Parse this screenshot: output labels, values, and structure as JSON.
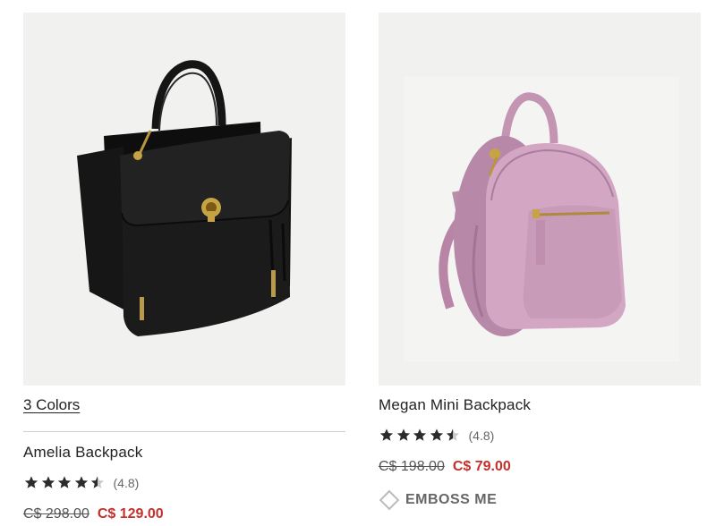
{
  "products": [
    {
      "colors_label": "3 Colors",
      "name": "Amelia Backpack",
      "rating": 4.5,
      "rating_text": "(4.8)",
      "original_price": "C$ 298.00",
      "sale_price": "C$ 129.00",
      "image_color": "#141414"
    },
    {
      "name": "Megan Mini Backpack",
      "rating": 4.5,
      "rating_text": "(4.8)",
      "original_price": "C$ 198.00",
      "sale_price": "C$ 79.00",
      "emboss_label": "EMBOSS ME",
      "image_color": "#c99bb8"
    }
  ],
  "colors": {
    "sale_red": "#c4302b",
    "image_bg": "#f1f1f0",
    "star": "#2b2b2b"
  },
  "icons": {
    "rating": "star-icon",
    "emboss": "diamond-icon"
  }
}
